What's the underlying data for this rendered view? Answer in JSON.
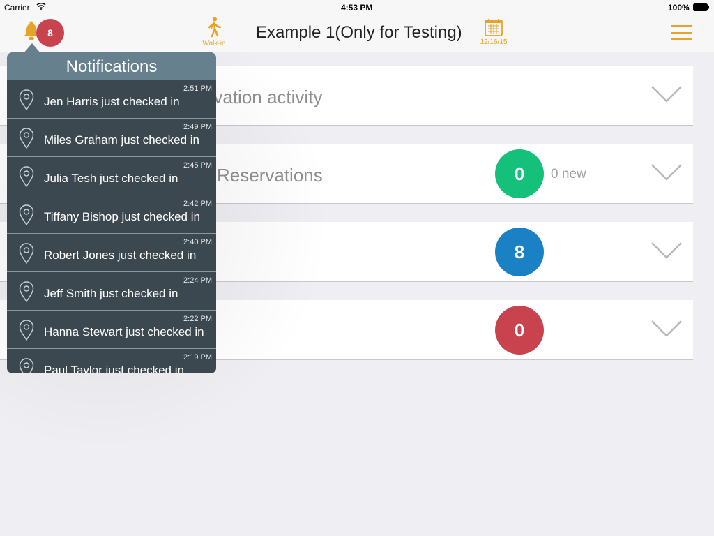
{
  "status_bar": {
    "carrier": "Carrier",
    "time": "4:53 PM",
    "battery": "100%"
  },
  "nav": {
    "title": "Example 1(Only for Testing)",
    "walkin_label": "Walk-in",
    "date": "12/16/15",
    "notification_count": "8"
  },
  "cards": [
    {
      "label": "Reservation activity"
    },
    {
      "label": "Reservations",
      "count": "0",
      "count_color": "#14c07a",
      "new_text": "0 new"
    },
    {
      "label": "",
      "count": "8",
      "count_color": "#1a82c4"
    },
    {
      "label": "",
      "count": "0",
      "count_color": "#c9434f"
    }
  ],
  "notifications": {
    "title": "Notifications",
    "items": [
      {
        "time": "2:51 PM",
        "text": "Jen Harris just checked in"
      },
      {
        "time": "2:49 PM",
        "text": "Miles Graham just checked in"
      },
      {
        "time": "2:45 PM",
        "text": "Julia Tesh just checked in"
      },
      {
        "time": "2:42 PM",
        "text": "Tiffany Bishop just checked in"
      },
      {
        "time": "2:40 PM",
        "text": "Robert Jones just checked in"
      },
      {
        "time": "2:24 PM",
        "text": "Jeff Smith just checked in"
      },
      {
        "time": "2:22 PM",
        "text": "Hanna Stewart just checked in"
      },
      {
        "time": "2:19 PM",
        "text": "Paul Taylor just checked in"
      }
    ]
  },
  "colors": {
    "accent": "#e8a229",
    "popover_header": "#66808e",
    "popover_body": "#3c4850"
  }
}
